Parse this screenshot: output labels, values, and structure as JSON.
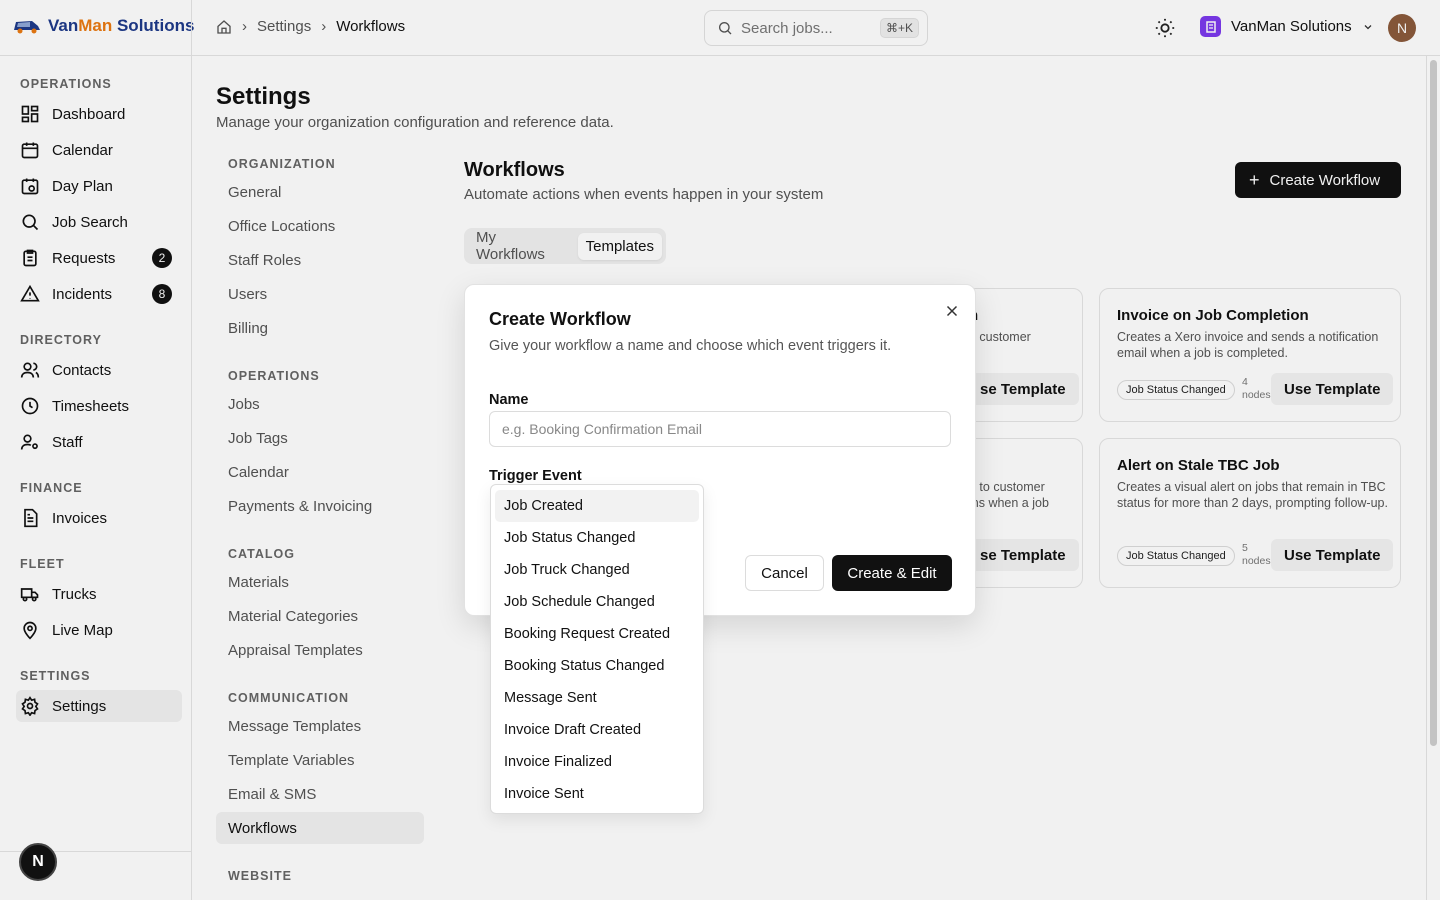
{
  "brand": {
    "part1": "Van",
    "part2": "Man",
    "part3": " Solutions"
  },
  "breadcrumb": {
    "home_icon": "home-icon",
    "items": [
      "Settings",
      "Workflows"
    ]
  },
  "search": {
    "placeholder": "Search jobs...",
    "shortcut": "⌘+K"
  },
  "org": {
    "name": "VanMan Solutions"
  },
  "user": {
    "initial": "N"
  },
  "sidebar": {
    "sections": [
      {
        "label": "OPERATIONS",
        "items": [
          {
            "label": "Dashboard",
            "icon": "dashboard-icon"
          },
          {
            "label": "Calendar",
            "icon": "calendar-icon"
          },
          {
            "label": "Day Plan",
            "icon": "day-plan-icon"
          },
          {
            "label": "Job Search",
            "icon": "search-icon"
          },
          {
            "label": "Requests",
            "icon": "clipboard-icon",
            "badge": "2"
          },
          {
            "label": "Incidents",
            "icon": "warning-icon",
            "badge": "8"
          }
        ]
      },
      {
        "label": "DIRECTORY",
        "items": [
          {
            "label": "Contacts",
            "icon": "contacts-icon"
          },
          {
            "label": "Timesheets",
            "icon": "clock-icon"
          },
          {
            "label": "Staff",
            "icon": "staff-icon"
          }
        ]
      },
      {
        "label": "FINANCE",
        "items": [
          {
            "label": "Invoices",
            "icon": "invoice-icon"
          }
        ]
      },
      {
        "label": "FLEET",
        "items": [
          {
            "label": "Trucks",
            "icon": "truck-icon"
          },
          {
            "label": "Live Map",
            "icon": "map-pin-icon"
          }
        ]
      },
      {
        "label": "SETTINGS",
        "items": [
          {
            "label": "Settings",
            "icon": "gear-icon"
          }
        ]
      }
    ],
    "bubble": "N"
  },
  "page": {
    "title": "Settings",
    "subtitle": "Manage your organization configuration and reference data."
  },
  "settings_nav": {
    "sections": [
      {
        "label": "ORGANIZATION",
        "items": [
          "General",
          "Office Locations",
          "Staff Roles",
          "Users",
          "Billing"
        ]
      },
      {
        "label": "OPERATIONS",
        "items": [
          "Jobs",
          "Job Tags",
          "Calendar",
          "Payments & Invoicing"
        ]
      },
      {
        "label": "CATALOG",
        "items": [
          "Materials",
          "Material Categories",
          "Appraisal Templates"
        ]
      },
      {
        "label": "COMMUNICATION",
        "items": [
          "Message Templates",
          "Template Variables",
          "Email & SMS",
          "Workflows"
        ]
      },
      {
        "label": "WEBSITE",
        "items": []
      }
    ],
    "active": "Workflows"
  },
  "workflows": {
    "title": "Workflows",
    "subtitle": "Automate actions when events happen in your system",
    "create_label": "Create Workflow",
    "tabs": [
      "My Workflows",
      "Templates"
    ],
    "active_tab": "Templates",
    "cards": [
      {
        "title": "n",
        "desc": "e customer",
        "use": "se Template"
      },
      {
        "title": "Invoice on Job Completion",
        "desc": "Creates a Xero invoice and sends a notification email when a job is completed.",
        "chip": "Job Status Changed",
        "nodes_num": "4",
        "nodes_word": "nodes",
        "use": "Use Template"
      },
      {
        "title": "",
        "desc": "n to customer\nins when a job",
        "use": "se Template"
      },
      {
        "title": "Alert on Stale TBC Job",
        "desc": "Creates a visual alert on jobs that remain in TBC status for more than 2 days, prompting follow-up.",
        "chip": "Job Status Changed",
        "nodes_num": "5",
        "nodes_word": "nodes",
        "use": "Use Template"
      }
    ]
  },
  "dialog": {
    "title": "Create Workflow",
    "subtitle": "Give your workflow a name and choose which event triggers it.",
    "name_label": "Name",
    "name_placeholder": "e.g. Booking Confirmation Email",
    "trigger_label": "Trigger Event",
    "cancel_label": "Cancel",
    "create_label": "Create & Edit",
    "options": [
      "Job Created",
      "Job Status Changed",
      "Job Truck Changed",
      "Job Schedule Changed",
      "Booking Request Created",
      "Booking Status Changed",
      "Message Sent",
      "Invoice Draft Created",
      "Invoice Finalized",
      "Invoice Sent"
    ],
    "highlighted": "Job Created"
  }
}
